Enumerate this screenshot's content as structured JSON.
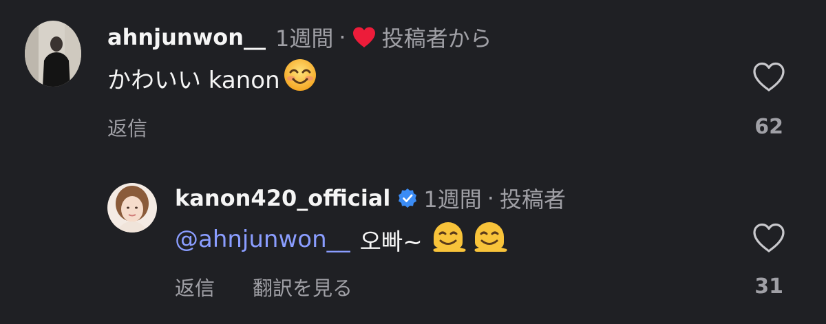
{
  "comments": [
    {
      "username": "ahnjunwon__",
      "time": "1週間",
      "separator": "·",
      "author_like_label": "投稿者から",
      "text": "かわいい kanon",
      "reply_label": "返信",
      "like_count": "62",
      "emoji": "smiling-face-icon"
    },
    {
      "username": "kanon420_official",
      "verified": true,
      "time": "1週間",
      "separator": "·",
      "author_label": "投稿者",
      "mention": "@ahnjunwon__",
      "text": "오빠~",
      "reply_label": "返信",
      "translate_label": "翻訳を見る",
      "like_count": "31",
      "emoji": "melting-face-icon"
    }
  ],
  "colors": {
    "background": "#1f2024",
    "primary_text": "#f5f5f5",
    "secondary_text": "#a0a0a6",
    "mention": "#8a9dff",
    "heart_red": "#ed1c3a",
    "verified_blue": "#3b8cf5"
  }
}
